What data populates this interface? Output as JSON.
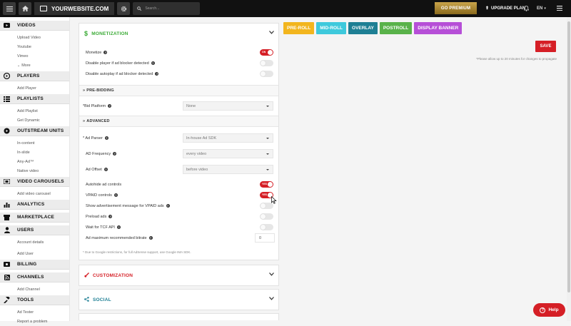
{
  "topbar": {
    "site_name": "YOURWEBSITE.COM",
    "search_placeholder": "Search...",
    "premium_label": "GO PREMIUM",
    "upgrade_label": "UPGRADE PLAN",
    "language": "EN"
  },
  "sidebar": {
    "videos": {
      "title": "VIDEOS",
      "items": [
        "Upload Video",
        "Youtube",
        "Vimeo",
        "More"
      ]
    },
    "players": {
      "title": "PLAYERS",
      "items": [
        "Add Player"
      ]
    },
    "playlists": {
      "title": "PLAYLISTS",
      "items": [
        "Add Playlist",
        "Get Dynamic"
      ]
    },
    "outstream": {
      "title": "OUTSTREAM UNITS",
      "items": [
        "In-content",
        "In-slide",
        "Any-Ad™",
        "Native video"
      ]
    },
    "carousels": {
      "title": "VIDEO CAROUSELS",
      "items": [
        "Add video carousel"
      ]
    },
    "analytics": {
      "title": "ANALYTICS"
    },
    "marketplace": {
      "title": "MARKETPLACE"
    },
    "users": {
      "title": "USERS",
      "items": [
        "Account details",
        "Add User"
      ]
    },
    "billing": {
      "title": "BILLING"
    },
    "channels": {
      "title": "CHANNELS",
      "items": [
        "Add Channel"
      ]
    },
    "tools": {
      "title": "TOOLS",
      "items": [
        "Ad Tester",
        "Report a problem"
      ]
    }
  },
  "monetization": {
    "title": "MONETIZATION",
    "toggles": {
      "monetize": {
        "label": "Monetize",
        "on": true,
        "text": "ON"
      },
      "disable_adblock": {
        "label": "Disable player if ad blocker detected",
        "on": false
      },
      "disable_autoplay": {
        "label": "Disable autoplay if ad blocker detected",
        "on": false
      }
    },
    "prebidding": {
      "title": "PRE-BIDDING",
      "bid_platform": {
        "label": "*Bid Platform",
        "value": "None"
      }
    },
    "advanced": {
      "title": "ADVANCED",
      "ad_parser": {
        "label": "* Ad Parser",
        "value": "In-house Ad SDK"
      },
      "ad_frequency": {
        "label": "AD Frequency",
        "value": "every video"
      },
      "ad_offset": {
        "label": "Ad Offset",
        "value": "before video"
      },
      "autohide": {
        "label": "Autohide ad controls",
        "on": true,
        "text": "YES"
      },
      "vpaid": {
        "label": "VPAID controls",
        "on": true,
        "text": "YES"
      },
      "show_msg": {
        "label": "Show advertisement message for VPAID ads",
        "on": false
      },
      "preload": {
        "label": "Preload ads",
        "on": false
      },
      "wait_tcf": {
        "label": "Wait for TCF API",
        "on": false
      },
      "bitrate": {
        "label": "Ad maximum recommended bitrate",
        "value": "0"
      }
    },
    "note": "* Due to Google restrictions, for full AdSense support, use Google IMA SDK."
  },
  "customization": {
    "title": "CUSTOMIZATION"
  },
  "social": {
    "title": "SOCIAL"
  },
  "ad_tabs": [
    {
      "label": "PRE-ROLL",
      "color": "#f2b51e"
    },
    {
      "label": "MID-ROLL",
      "color": "#3ec9dc"
    },
    {
      "label": "OVERLAY",
      "color": "#1e7f94"
    },
    {
      "label": "POSTROLL",
      "color": "#59b24a"
    },
    {
      "label": "DISPLAY BANNER",
      "color": "#b64fd7"
    }
  ],
  "save_label": "SAVE",
  "save_note": "*Please allow up to 20 minutes for changes to propagate",
  "help_label": "Help",
  "colors": {
    "accent": "#d51f26",
    "monetization_green": "#3aaa35",
    "customization_red": "#d51f26",
    "social_blue": "#1e7f94"
  }
}
